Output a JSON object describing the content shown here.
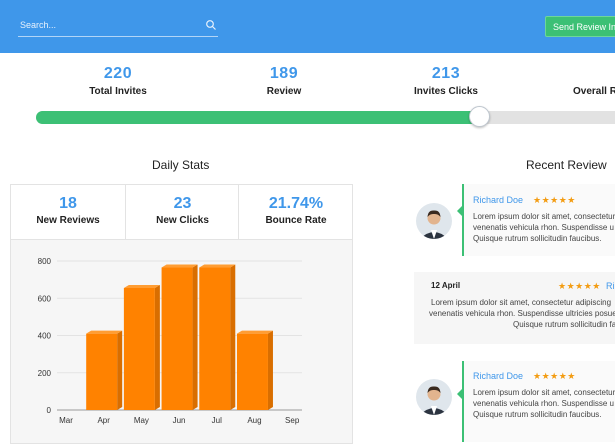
{
  "search": {
    "placeholder": "Search..."
  },
  "header": {
    "send_button": "Send Review Invites"
  },
  "stats": [
    {
      "value": "220",
      "label": "Total Invites"
    },
    {
      "value": "189",
      "label": "Review"
    },
    {
      "value": "213",
      "label": "Invites Clicks"
    },
    {
      "value": "",
      "label": "Overall R"
    }
  ],
  "progress": {
    "percent": 74
  },
  "daily": {
    "title": "Daily Stats",
    "kpis": [
      {
        "value": "18",
        "label": "New Reviews"
      },
      {
        "value": "23",
        "label": "New Clicks"
      },
      {
        "value": "21.74%",
        "label": "Bounce Rate"
      }
    ]
  },
  "chart_data": {
    "type": "bar",
    "categories": [
      "Mar",
      "Apr",
      "May",
      "Jun",
      "Jul",
      "Aug",
      "Sep"
    ],
    "values": [
      null,
      410,
      655,
      765,
      765,
      410,
      null
    ],
    "yticks": [
      0,
      200,
      400,
      600,
      800
    ],
    "ylim": [
      0,
      800
    ],
    "bar_color": "#ff8200",
    "grid": true
  },
  "recent": {
    "title": "Recent Review",
    "items": [
      {
        "name": "Richard Doe",
        "stars": "★★★★★",
        "lines": [
          "Lorem ipsum dolor sit amet, consectetur",
          "venenatis vehicula rhon. Suspendisse u",
          "Quisque rutrum sollicitudin faucibus."
        ]
      },
      {
        "date": "12 April",
        "stars": "★★★★★",
        "name": "Ri",
        "lines": [
          "Lorem ipsum dolor sit amet, consectetur adipiscing",
          "venenatis vehicula rhon. Suspendisse ultricies posue",
          "Quisque rutrum sollicitudin fau"
        ]
      },
      {
        "name": "Richard Doe",
        "stars": "★★★★★",
        "lines": [
          "Lorem ipsum dolor sit amet, consectetur",
          "venenatis vehicula rhon. Suspendisse u",
          "Quisque rutrum sollicitudin faucibus."
        ]
      }
    ]
  },
  "colors": {
    "primary": "#3f97ea",
    "success": "#3cc075",
    "bar": "#ff8200",
    "stars": "#f39c12"
  }
}
